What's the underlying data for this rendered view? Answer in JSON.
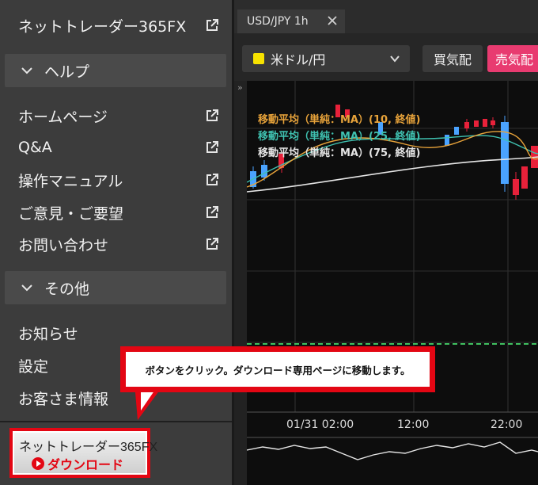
{
  "sidebar": {
    "top_link": {
      "label": "ネットトレーダー365FX",
      "icon": "external-link-icon"
    },
    "help_section": {
      "title": "ヘルプ",
      "items": [
        {
          "label": "ホームページ",
          "icon": "external-link-icon"
        },
        {
          "label": "Q&A",
          "icon": "external-link-icon"
        },
        {
          "label": "操作マニュアル",
          "icon": "external-link-icon"
        },
        {
          "label": "ご意見・ご要望",
          "icon": "external-link-icon"
        },
        {
          "label": "お問い合わせ",
          "icon": "external-link-icon"
        }
      ]
    },
    "other_section": {
      "title": "その他",
      "items": [
        {
          "label": "お知らせ"
        },
        {
          "label": "設定"
        },
        {
          "label": "お客さま情報"
        }
      ]
    },
    "download_badge": {
      "title": "ネットトレーダー365FX",
      "button_label": "ダウンロード"
    }
  },
  "chart_panel": {
    "tab": {
      "label": "USD/JPY 1h"
    },
    "symbol_select": {
      "value": "米ドル/円",
      "color": "#f7e200"
    },
    "buy_label": "買気配",
    "sell_label": "売気配",
    "indicators": [
      {
        "label": "移動平均（単純：MA）(10, 終値)",
        "color": "#e8a33a"
      },
      {
        "label": "移動平均（単純：MA）(25, 終値)",
        "color": "#3fc1b0"
      },
      {
        "label": "移動平均（単純：MA）(75, 終値)",
        "color": "#e6e6e6"
      }
    ],
    "time_axis": [
      "01/31 02:00",
      "12:00",
      "22:00"
    ]
  },
  "callout": {
    "text": "ボタンをクリック。ダウンロード専用ページに移動します。"
  },
  "colors": {
    "sidebar_bg": "#3c3c3c",
    "section_bg": "#4a4a4a",
    "callout_red": "#e30613",
    "sell_pink": "#e83b70",
    "candle_up": "#4aa3ff",
    "candle_down": "#e8213a"
  }
}
